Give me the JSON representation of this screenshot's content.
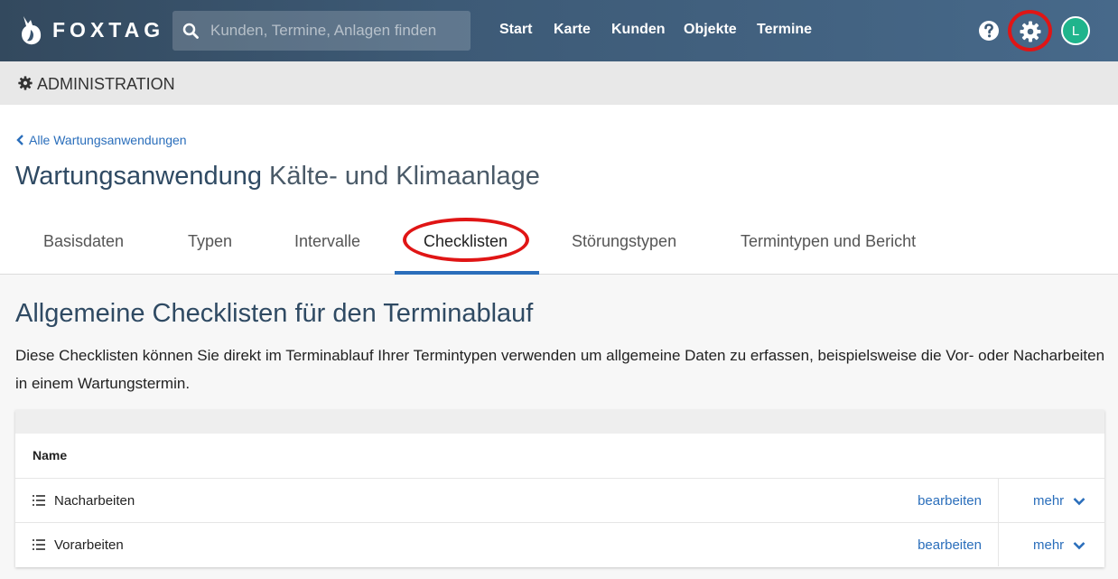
{
  "navbar": {
    "logo_text": "FOXTAG",
    "search_placeholder": "Kunden, Termine, Anlagen finden",
    "links": [
      "Start",
      "Karte",
      "Kunden",
      "Objekte",
      "Termine"
    ],
    "avatar_initial": "L"
  },
  "admin": {
    "label": "ADMINISTRATION"
  },
  "header": {
    "back_label": "Alle Wartungsanwendungen",
    "title": "Wartungsanwendung",
    "subtitle": "Kälte- und Klimaanlage",
    "tabs": [
      "Basisdaten",
      "Typen",
      "Intervalle",
      "Checklisten",
      "Störungstypen",
      "Termintypen und Bericht"
    ],
    "active_tab": "Checklisten"
  },
  "content": {
    "title": "Allgemeine Checklisten für den Terminablauf",
    "description": "Diese Checklisten können Sie direkt im Terminablauf Ihrer Termintypen verwenden um allgemeine Daten zu erfassen, beispielsweise die Vor- oder Nacharbeiten in einem Wartungstermin.",
    "table": {
      "column_name": "Name",
      "rows": [
        {
          "name": "Nacharbeiten",
          "edit": "bearbeiten",
          "more": "mehr"
        },
        {
          "name": "Vorarbeiten",
          "edit": "bearbeiten",
          "more": "mehr"
        }
      ]
    }
  },
  "colors": {
    "accent": "#2a6ebb",
    "annotation": "#e01515",
    "avatar": "#1fb48c"
  }
}
